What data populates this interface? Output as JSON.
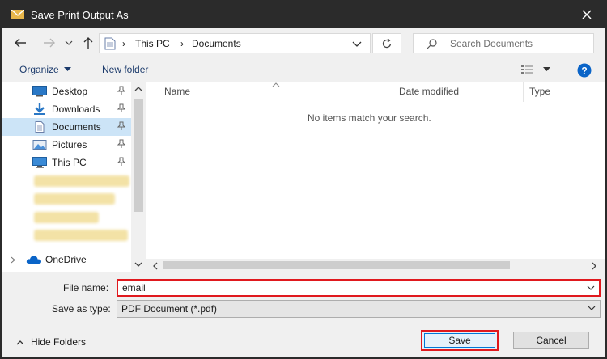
{
  "window": {
    "title": "Save Print Output As"
  },
  "nav": {
    "breadcrumbs": [
      "This PC",
      "Documents"
    ],
    "search_placeholder": "Search Documents"
  },
  "toolbar": {
    "organize_label": "Organize",
    "new_folder_label": "New folder"
  },
  "sidebar": {
    "items": [
      {
        "label": "Desktop",
        "icon": "desktop-icon",
        "pinned": true
      },
      {
        "label": "Downloads",
        "icon": "download-icon",
        "pinned": true
      },
      {
        "label": "Documents",
        "icon": "documents-icon",
        "pinned": true,
        "selected": true
      },
      {
        "label": "Pictures",
        "icon": "pictures-icon",
        "pinned": true
      },
      {
        "label": "This PC",
        "icon": "this-pc-icon",
        "pinned": true
      }
    ],
    "onedrive_label": "OneDrive"
  },
  "content": {
    "columns": [
      "Name",
      "Date modified",
      "Type"
    ],
    "empty_message": "No items match your search."
  },
  "form": {
    "filename_label": "File name:",
    "filename_value": "email",
    "savetype_label": "Save as type:",
    "savetype_value": "PDF Document (*.pdf)"
  },
  "buttons": {
    "hide_folders_label": "Hide Folders",
    "save_label": "Save",
    "cancel_label": "Cancel"
  },
  "colors": {
    "accent": "#0078d7",
    "highlight": "#e0191e",
    "titlebar": "#2b2b2b",
    "selected": "#cce4f7"
  }
}
